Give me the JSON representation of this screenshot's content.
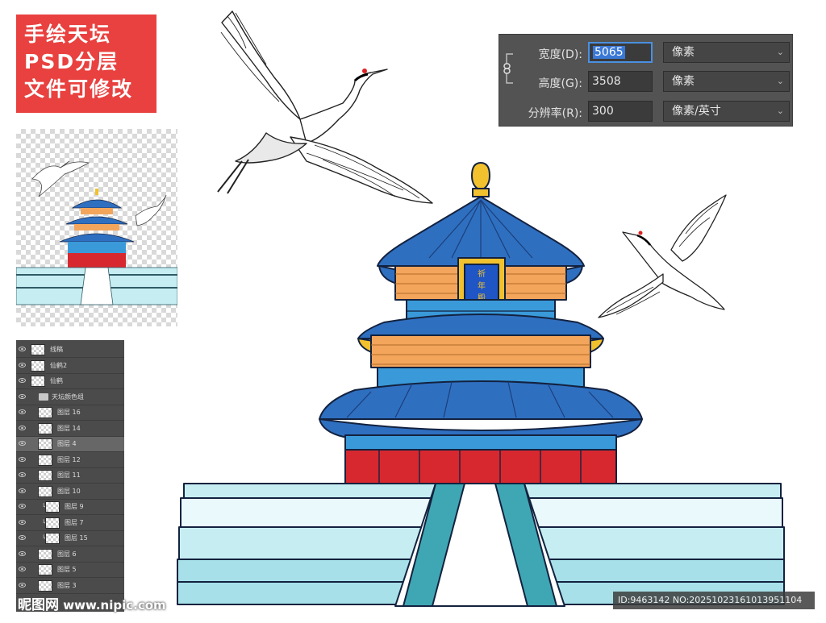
{
  "badge": {
    "line1": "手绘天坛",
    "line2": "PSD分层",
    "line3": "文件可修改"
  },
  "dialog": {
    "width_label": "宽度(D):",
    "width_value": "5065",
    "width_unit": "像素",
    "height_label": "高度(G):",
    "height_value": "3508",
    "height_unit": "像素",
    "resolution_label": "分辨率(R):",
    "resolution_value": "300",
    "resolution_unit": "像素/英寸"
  },
  "layers": [
    {
      "name": "线稿",
      "indent": 0,
      "type": "layer"
    },
    {
      "name": "仙鹤2",
      "indent": 0,
      "type": "layer"
    },
    {
      "name": "仙鹤",
      "indent": 0,
      "type": "layer"
    },
    {
      "name": "天坛颜色组",
      "indent": 0,
      "type": "group"
    },
    {
      "name": "图层 16",
      "indent": 1,
      "type": "layer"
    },
    {
      "name": "图层 14",
      "indent": 1,
      "type": "layer"
    },
    {
      "name": "图层 4",
      "indent": 1,
      "type": "layer",
      "active": true
    },
    {
      "name": "图层 12",
      "indent": 1,
      "type": "layer"
    },
    {
      "name": "图层 11",
      "indent": 1,
      "type": "layer"
    },
    {
      "name": "图层 10",
      "indent": 1,
      "type": "layer"
    },
    {
      "name": "图层 9",
      "indent": 2,
      "type": "layer"
    },
    {
      "name": "图层 7",
      "indent": 2,
      "type": "layer"
    },
    {
      "name": "图层 15",
      "indent": 2,
      "type": "layer"
    },
    {
      "name": "图层 6",
      "indent": 1,
      "type": "layer"
    },
    {
      "name": "图层 5",
      "indent": 1,
      "type": "layer"
    },
    {
      "name": "图层 3",
      "indent": 1,
      "type": "layer"
    }
  ],
  "temple_plaque": "祈年殿",
  "watermark_left_logo": "昵图网",
  "watermark_left_url": "www.nipic.com",
  "watermark_right": "ID:9463142 NO:20251023161013951104",
  "colors": {
    "badge_red": "#e8413f",
    "roof_blue": "#2f6fc0",
    "wall_red": "#d8282f",
    "gold": "#f2c12e",
    "tile_orange": "#f3a55c",
    "balustrade": "#c6eef2"
  }
}
